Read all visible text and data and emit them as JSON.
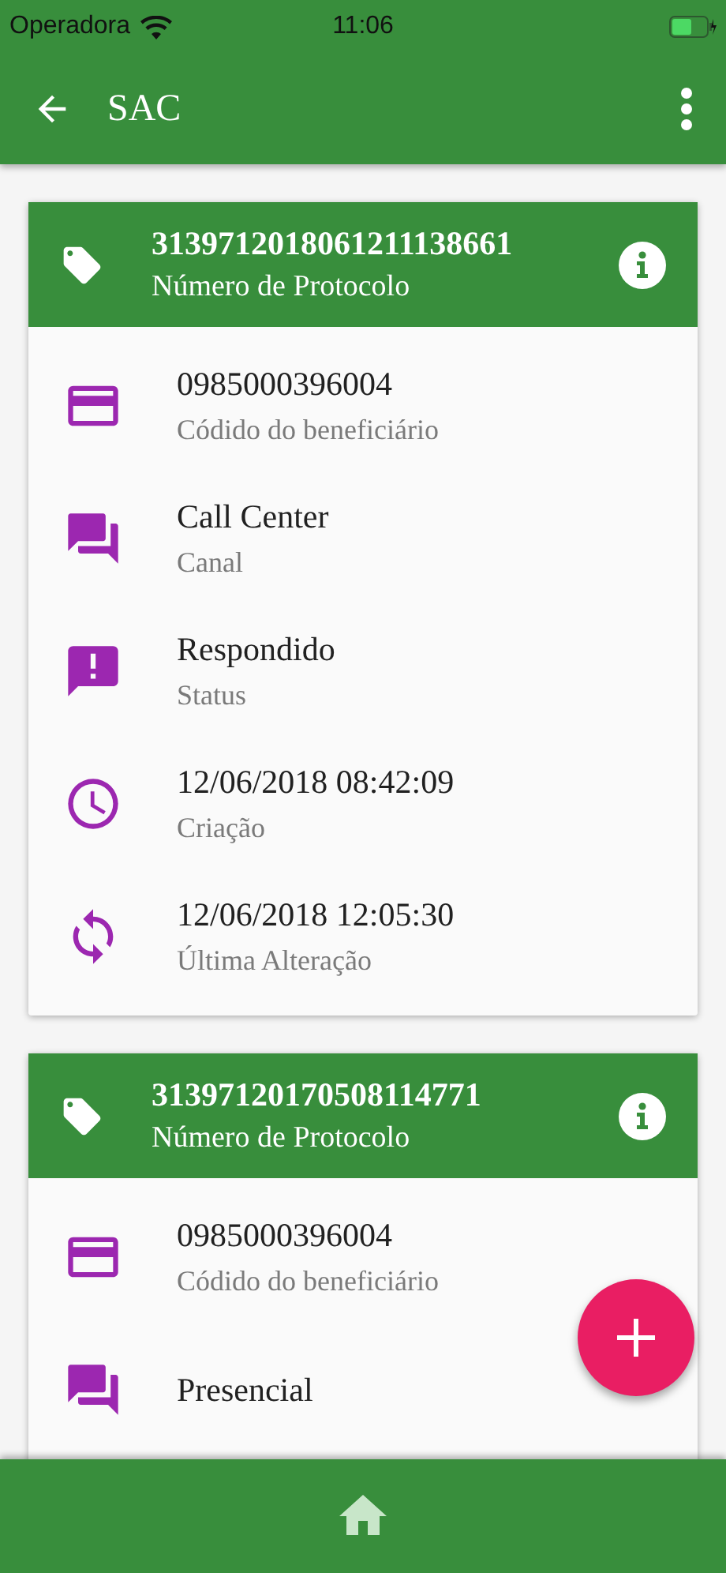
{
  "status_bar": {
    "carrier": "Operadora",
    "time": "11:06"
  },
  "app_bar": {
    "title": "SAC"
  },
  "protocols": [
    {
      "number": "3139712018061211138661",
      "number_label": "Número de Protocolo",
      "fields": [
        {
          "kind": "card",
          "value": "0985000396004",
          "label": "Códido do beneficiário"
        },
        {
          "kind": "chat",
          "value": "Call Center",
          "label": "Canal"
        },
        {
          "kind": "alert",
          "value": "Respondido",
          "label": "Status"
        },
        {
          "kind": "clock",
          "value": "12/06/2018 08:42:09",
          "label": "Criação"
        },
        {
          "kind": "sync",
          "value": "12/06/2018 12:05:30",
          "label": "Última Alteração"
        }
      ]
    },
    {
      "number": "31397120170508114771",
      "number_label": "Número de Protocolo",
      "fields": [
        {
          "kind": "card",
          "value": "0985000396004",
          "label": "Códido do beneficiário"
        },
        {
          "kind": "chat",
          "value": "Presencial"
        }
      ]
    }
  ]
}
